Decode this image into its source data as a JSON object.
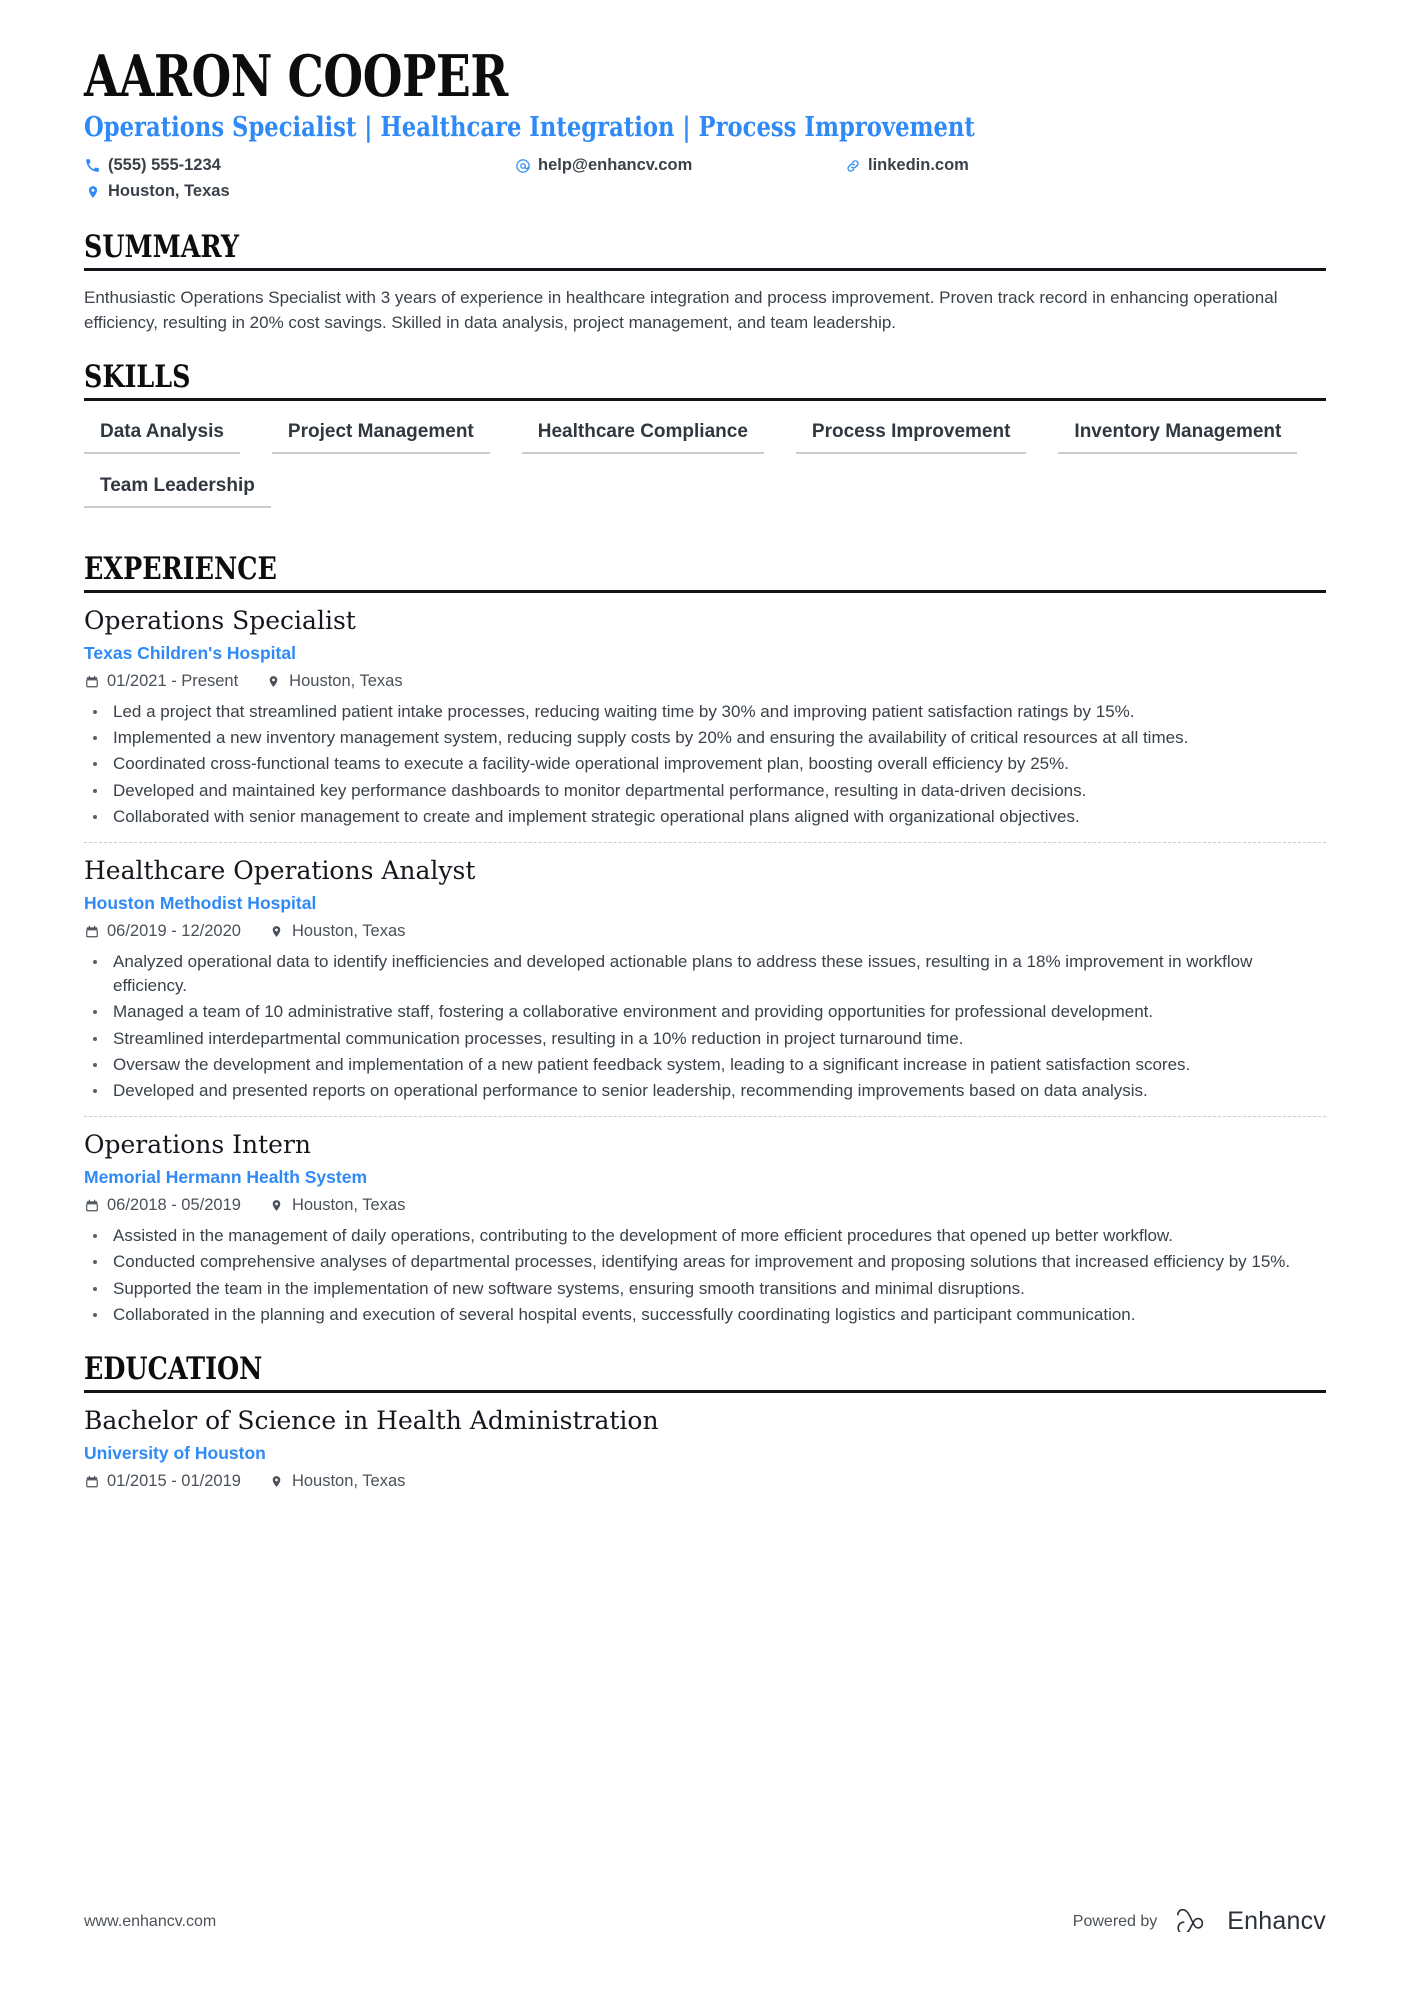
{
  "header": {
    "name": "AARON COOPER",
    "headline": "Operations Specialist | Healthcare Integration | Process Improvement",
    "contacts": [
      {
        "icon": "phone-icon",
        "text": "(555) 555-1234"
      },
      {
        "icon": "email-icon",
        "text": "help@enhancv.com"
      },
      {
        "icon": "link-icon",
        "text": "linkedin.com"
      },
      {
        "icon": "location-icon",
        "text": "Houston, Texas"
      }
    ]
  },
  "summary": {
    "title": "SUMMARY",
    "text": "Enthusiastic Operations Specialist with 3 years of experience in healthcare integration and process improvement. Proven track record in enhancing operational efficiency, resulting in 20% cost savings. Skilled in data analysis, project management, and team leadership."
  },
  "skills": {
    "title": "SKILLS",
    "items": [
      "Data Analysis",
      "Project Management",
      "Healthcare Compliance",
      "Process Improvement",
      "Inventory Management",
      "Team Leadership"
    ]
  },
  "experience": {
    "title": "EXPERIENCE",
    "items": [
      {
        "role": "Operations Specialist",
        "company": "Texas Children's Hospital",
        "dates": "01/2021 - Present",
        "location": "Houston, Texas",
        "bullets": [
          "Led a project that streamlined patient intake processes, reducing waiting time by 30% and improving patient satisfaction ratings by 15%.",
          "Implemented a new inventory management system, reducing supply costs by 20% and ensuring the availability of critical resources at all times.",
          "Coordinated cross-functional teams to execute a facility-wide operational improvement plan, boosting overall efficiency by 25%.",
          "Developed and maintained key performance dashboards to monitor departmental performance, resulting in data-driven decisions.",
          "Collaborated with senior management to create and implement strategic operational plans aligned with organizational objectives."
        ]
      },
      {
        "role": "Healthcare Operations Analyst",
        "company": "Houston Methodist Hospital",
        "dates": "06/2019 - 12/2020",
        "location": "Houston, Texas",
        "bullets": [
          "Analyzed operational data to identify inefficiencies and developed actionable plans to address these issues, resulting in a 18% improvement in workflow efficiency.",
          "Managed a team of 10 administrative staff, fostering a collaborative environment and providing opportunities for professional development.",
          "Streamlined interdepartmental communication processes, resulting in a 10% reduction in project turnaround time.",
          "Oversaw the development and implementation of a new patient feedback system, leading to a significant increase in patient satisfaction scores.",
          "Developed and presented reports on operational performance to senior leadership, recommending improvements based on data analysis."
        ]
      },
      {
        "role": "Operations Intern",
        "company": "Memorial Hermann Health System",
        "dates": "06/2018 - 05/2019",
        "location": "Houston, Texas",
        "bullets": [
          "Assisted in the management of daily operations, contributing to the development of more efficient procedures that opened up better workflow.",
          "Conducted comprehensive analyses of departmental processes, identifying areas for improvement and proposing solutions that increased efficiency by 15%.",
          "Supported the team in the implementation of new software systems, ensuring smooth transitions and minimal disruptions.",
          "Collaborated in the planning and execution of several hospital events, successfully coordinating logistics and participant communication."
        ]
      }
    ]
  },
  "education": {
    "title": "EDUCATION",
    "items": [
      {
        "degree": "Bachelor of Science in Health Administration",
        "school": "University of Houston",
        "dates": "01/2015 - 01/2019",
        "location": "Houston, Texas"
      }
    ]
  },
  "footer": {
    "url": "www.enhancv.com",
    "powered_by": "Powered by",
    "brand": "Enhancv"
  },
  "colors": {
    "accent": "#2f8af5",
    "text": "#3a4149",
    "heading": "#0d0d0d",
    "rule": "#111418",
    "skill_underline": "#c8ccd0"
  }
}
